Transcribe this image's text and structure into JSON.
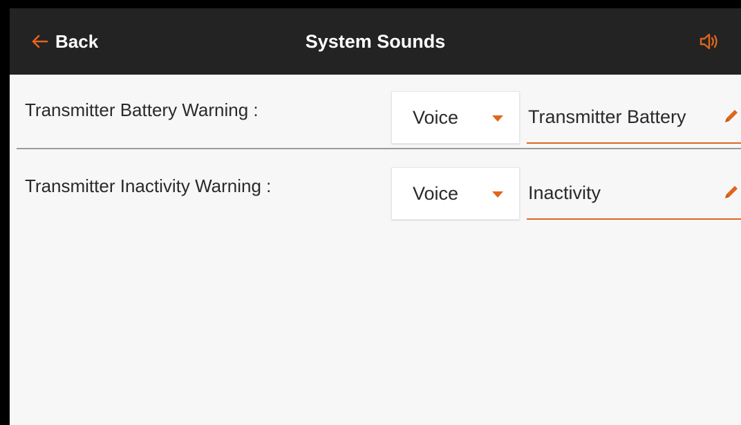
{
  "header": {
    "back_label": "Back",
    "title": "System Sounds",
    "back_icon": "arrow-left-icon",
    "sound_icon": "speaker-volume-icon"
  },
  "settings": [
    {
      "label": "Transmitter Battery Warning :",
      "mode": "Voice",
      "sound_name": "Transmitter Battery"
    },
    {
      "label": "Transmitter Inactivity Warning :",
      "mode": "Voice",
      "sound_name": "Inactivity"
    }
  ],
  "colors": {
    "accent": "#e0651c",
    "header_bg": "#232323",
    "page_bg": "#f7f7f7",
    "text": "#2a2a2a"
  }
}
